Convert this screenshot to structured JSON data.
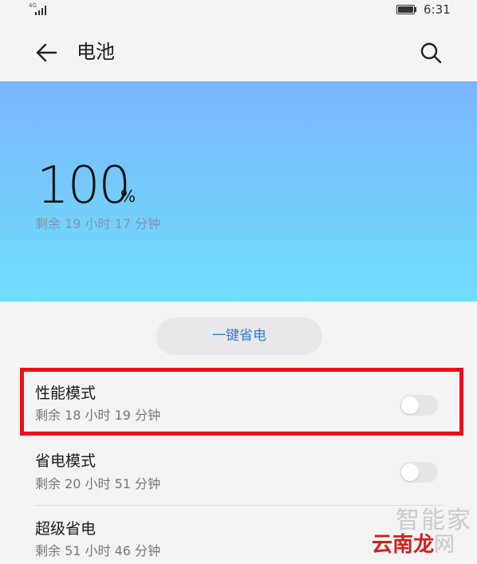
{
  "status_bar": {
    "network_type": "4G",
    "time": "6:31"
  },
  "header": {
    "title": "电池",
    "back_icon": "arrow-left-icon",
    "search_icon": "search-icon"
  },
  "battery": {
    "level_value": "100",
    "level_unit": "%",
    "remaining": "剩余 19 小时 17 分钟"
  },
  "one_key_save": {
    "label": "一键省电"
  },
  "modes": [
    {
      "name": "性能模式",
      "remaining": "剩余 18 小时 19 分钟",
      "enabled": false
    },
    {
      "name": "省电模式",
      "remaining": "剩余 20 小时 51 分钟",
      "enabled": false
    },
    {
      "name": "超级省电",
      "remaining": "剩余 51 小时 46 分钟"
    }
  ],
  "watermark": {
    "top": "智能家",
    "bottom_colored": "云南龙",
    "bottom_gray": "网"
  },
  "colors": {
    "accent_blue": "#2f7fd6",
    "highlight_red": "#e8101c",
    "hero_top": "#7ab5fd",
    "hero_bottom": "#71dcfb"
  }
}
